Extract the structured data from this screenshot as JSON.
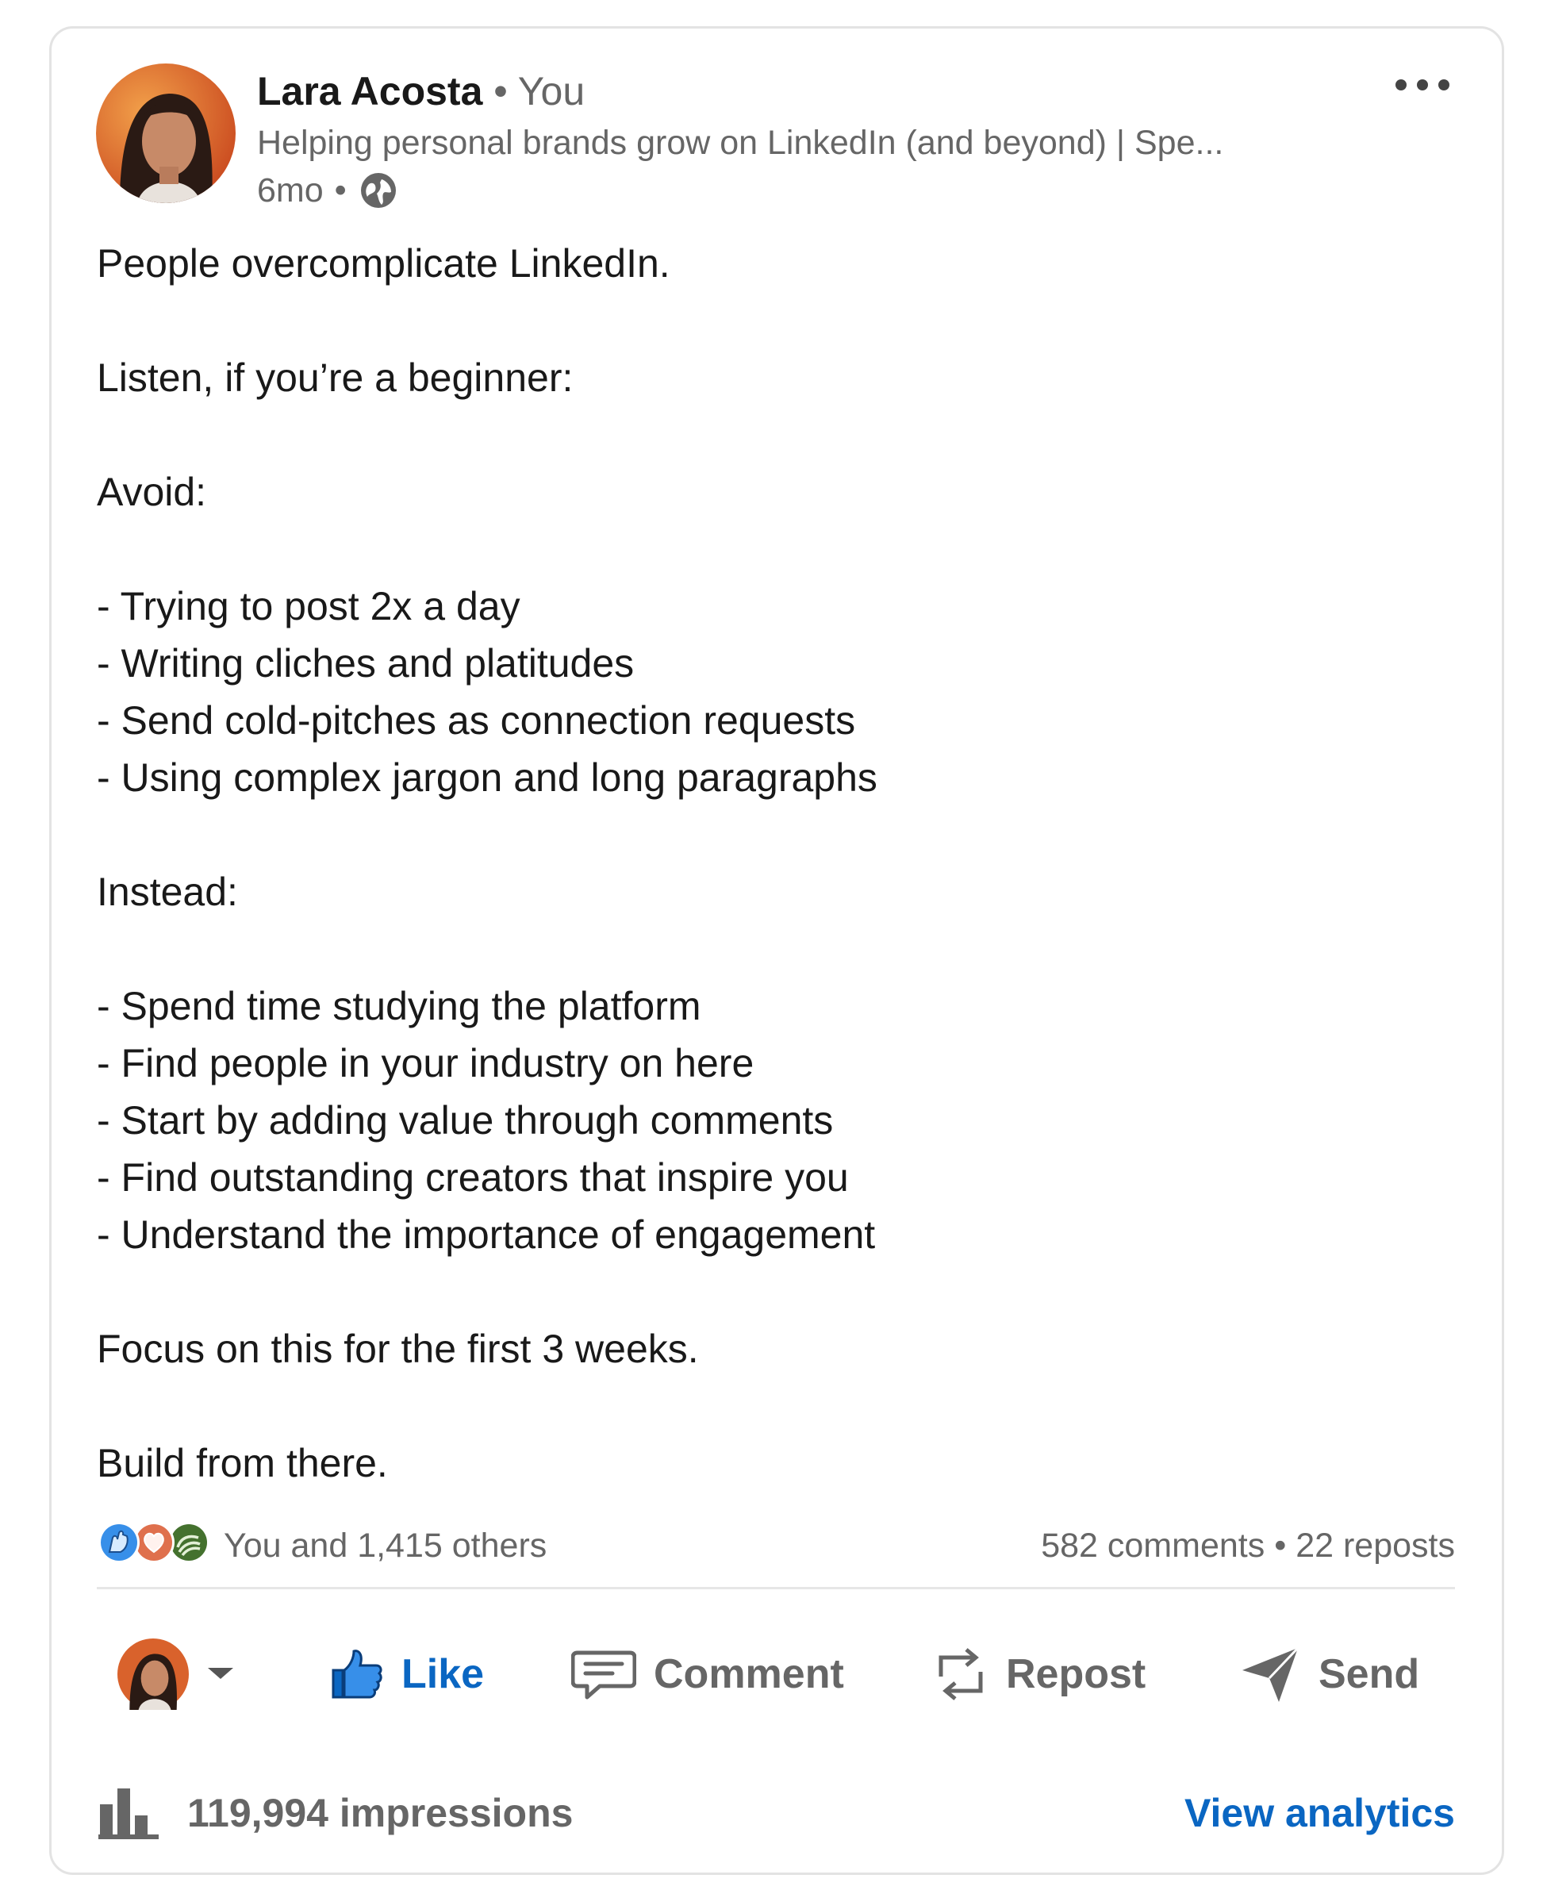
{
  "post": {
    "author": {
      "name": "Lara Acosta",
      "relation": "You",
      "headline": "Helping personal brands grow on LinkedIn (and beyond) | Spe...",
      "time": "6mo",
      "visibility_icon": "globe-icon"
    },
    "menu_icon": "more-horizontal-icon",
    "body_lines": [
      "People overcomplicate LinkedIn.",
      "",
      "Listen, if you’re a beginner:",
      "",
      "Avoid:",
      "",
      "- Trying to post 2x a day",
      "- Writing cliches and platitudes",
      "- Send cold-pitches as connection requests",
      "- Using complex jargon and long paragraphs",
      "",
      "Instead:",
      "",
      "- Spend time studying the platform",
      "- Find people in your industry on here",
      "- Start by adding value through comments",
      "- Find outstanding creators that inspire you",
      "- Understand the importance of engagement",
      "",
      "Focus on this for the first 3 weeks.",
      "",
      "Build from there."
    ],
    "reactions": {
      "icons": [
        "celebrate-icon",
        "love-icon",
        "support-icon"
      ],
      "summary": "You and 1,415 others"
    },
    "comments": "582 comments",
    "reposts": "22 reposts",
    "actions": {
      "like": "Like",
      "comment": "Comment",
      "repost": "Repost",
      "send": "Send"
    },
    "impressions": "119,994 impressions",
    "view_analytics": "View analytics"
  },
  "colors": {
    "accent": "#0a66c2",
    "text_primary": "#191919",
    "text_secondary": "#666666",
    "celebrate": "#378fe9",
    "love": "#df704d",
    "support": "#44712e"
  }
}
